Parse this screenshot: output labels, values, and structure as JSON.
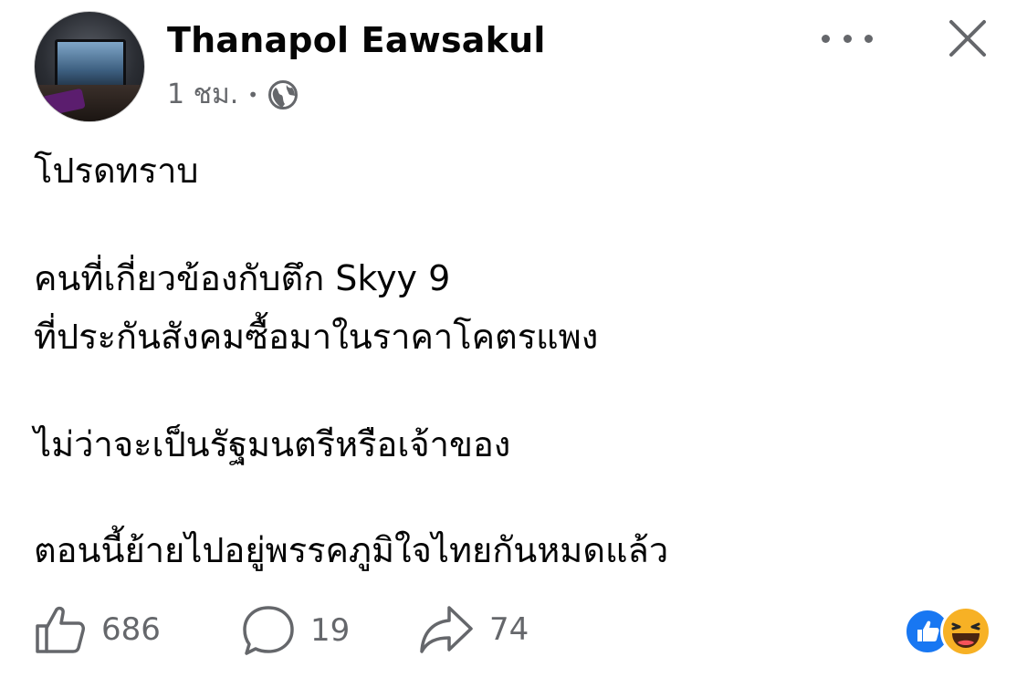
{
  "post": {
    "author": "Thanapol Eawsakul",
    "time": "1 ชม.",
    "separator": "•",
    "privacy_icon": "globe-icon",
    "body_lines": [
      "โปรดทราบ",
      "คนที่เกี่ยวข้องกับตึก Skyy 9",
      "ที่ประกันสังคมซื้อมาในราคาโคตรแพง",
      "ไม่ว่าจะเป็นรัฐมนตรีหรือเจ้าของ",
      "ตอนนี้ย้ายไปอยู่พรรคภูมิใจไทยกันหมดแล้ว"
    ]
  },
  "actions": {
    "likes": "686",
    "comments": "19",
    "shares": "74"
  },
  "reactions": [
    "like",
    "haha"
  ],
  "colors": {
    "text": "#050505",
    "secondary": "#65676b",
    "like_blue": "#1877f2",
    "haha_yellow": "#f7b125"
  }
}
